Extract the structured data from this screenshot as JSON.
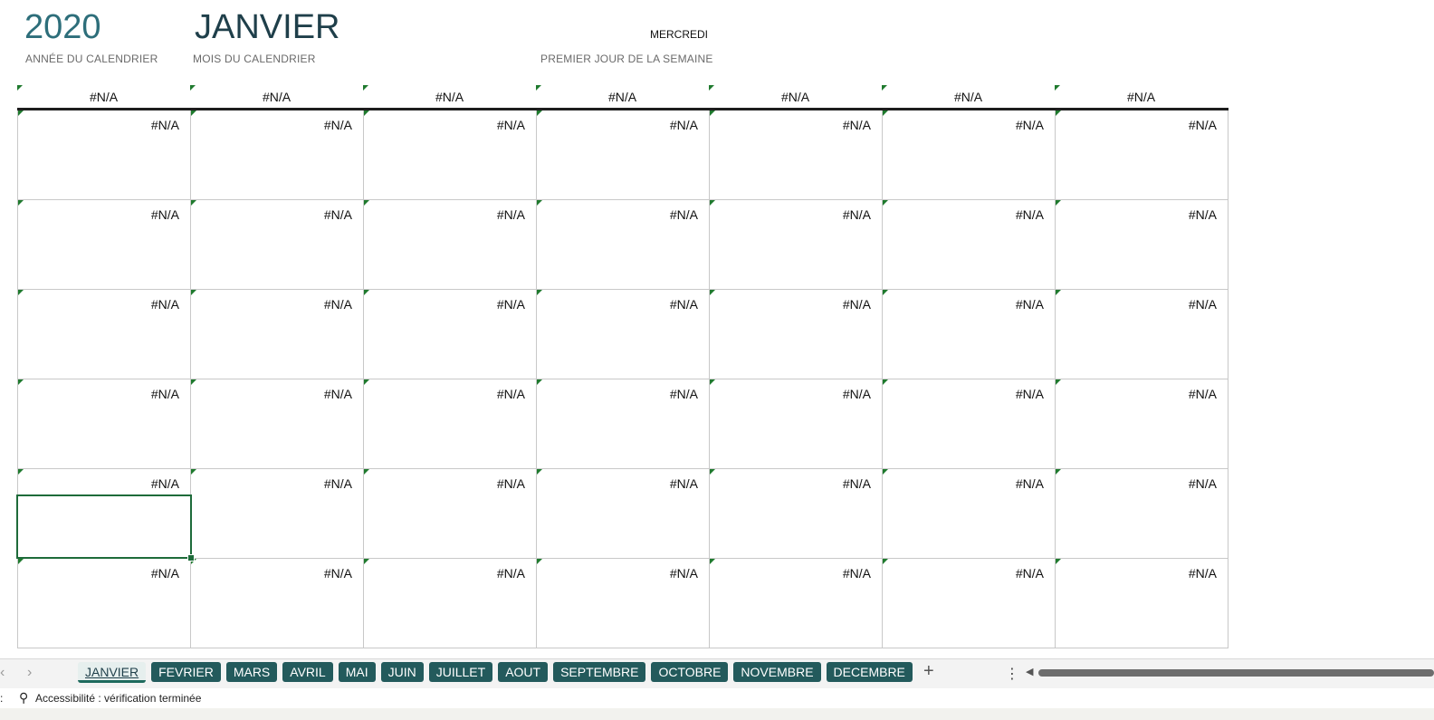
{
  "header": {
    "year": "2020",
    "month": "JANVIER",
    "year_label": "ANNÉE DU CALENDRIER",
    "month_label": "MOIS DU CALENDRIER",
    "first_day_label": "PREMIER JOUR DE LA SEMAINE",
    "first_day_value": "MERCREDI"
  },
  "calendar": {
    "weekday_headers": [
      "#N/A",
      "#N/A",
      "#N/A",
      "#N/A",
      "#N/A",
      "#N/A",
      "#N/A"
    ],
    "weeks": [
      [
        "#N/A",
        "#N/A",
        "#N/A",
        "#N/A",
        "#N/A",
        "#N/A",
        "#N/A"
      ],
      [
        "#N/A",
        "#N/A",
        "#N/A",
        "#N/A",
        "#N/A",
        "#N/A",
        "#N/A"
      ],
      [
        "#N/A",
        "#N/A",
        "#N/A",
        "#N/A",
        "#N/A",
        "#N/A",
        "#N/A"
      ],
      [
        "#N/A",
        "#N/A",
        "#N/A",
        "#N/A",
        "#N/A",
        "#N/A",
        "#N/A"
      ],
      [
        "#N/A",
        "#N/A",
        "#N/A",
        "#N/A",
        "#N/A",
        "#N/A",
        "#N/A"
      ],
      [
        "#N/A",
        "#N/A",
        "#N/A",
        "#N/A",
        "#N/A",
        "#N/A",
        "#N/A"
      ]
    ]
  },
  "sheet_tabs": {
    "active": "JANVIER",
    "items": [
      "JANVIER",
      "FEVRIER",
      "MARS",
      "AVRIL",
      "MAI",
      "JUIN",
      "JUILLET",
      "AOUT",
      "SEPTEMBRE",
      "OCTOBRE",
      "NOVEMBRE",
      "DECEMBRE"
    ],
    "add_icon": "+",
    "more_icon": "⋮"
  },
  "status_bar": {
    "accessibility_text": "Accessibilité : vérification terminée"
  },
  "colors": {
    "year": "#2d6e7a",
    "tab_bg": "#235a5c",
    "error_triangle": "#1f7a2e",
    "selection": "#1e6b3a"
  }
}
